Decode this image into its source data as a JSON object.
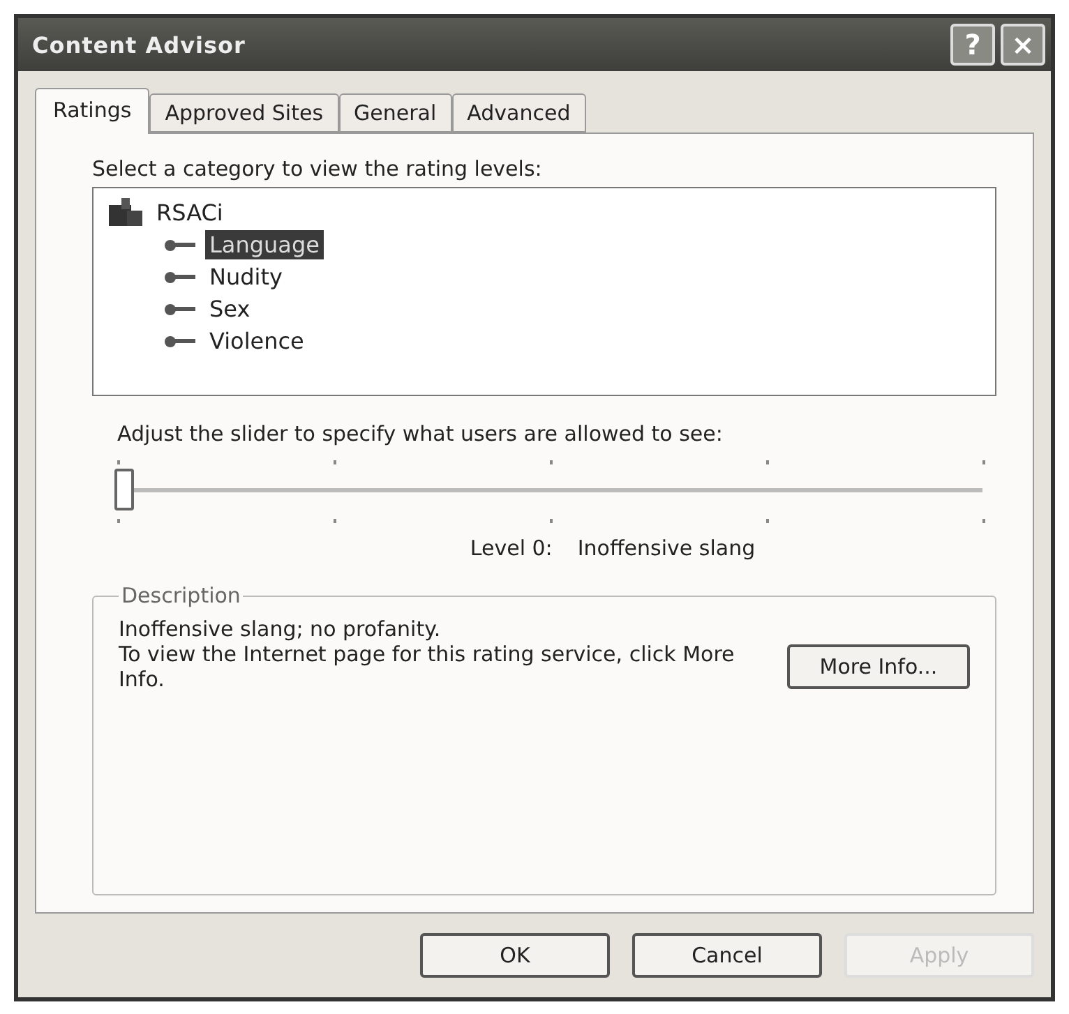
{
  "window": {
    "title": "Content Advisor",
    "help_button": "?",
    "close_button": "×"
  },
  "tabs": [
    {
      "label": "Ratings",
      "selected": true
    },
    {
      "label": "Approved Sites",
      "selected": false
    },
    {
      "label": "General",
      "selected": false
    },
    {
      "label": "Advanced",
      "selected": false
    }
  ],
  "category_label": "Select a category to view the rating levels:",
  "tree": [
    {
      "label": "RSACi",
      "selected": false,
      "children": [
        {
          "label": "Language",
          "selected": true
        },
        {
          "label": "Nudity",
          "selected": false
        },
        {
          "label": "Sex",
          "selected": false
        },
        {
          "label": "Violence",
          "selected": false
        }
      ]
    }
  ],
  "slider_label": "Adjust the slider to specify what users are allowed to see:",
  "slider": {
    "level": 0
  },
  "level_caption": "Level 0:",
  "level_name": "Inoffensive slang",
  "description": {
    "title": "Description",
    "text": "Inoffensive slang; no profanity.",
    "info_text": "To view the Internet page for this rating service, click More Info.",
    "more_button": "More Info..."
  },
  "buttons": [
    {
      "label": "OK",
      "disabled": false
    },
    {
      "label": "Cancel",
      "disabled": false
    },
    {
      "label": "Apply",
      "disabled": true
    }
  ]
}
